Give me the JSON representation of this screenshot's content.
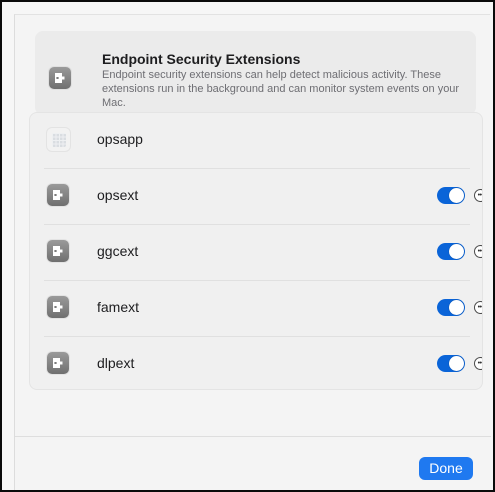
{
  "header": {
    "title": "Endpoint Security Extensions",
    "description": "Endpoint security extensions can help detect malicious activity. These extensions run in the background and can monitor system events on your Mac.",
    "icon": "extension-icon"
  },
  "extensions": [
    {
      "name": "opsapp",
      "icon": "app-grid-icon",
      "has_toggle": false
    },
    {
      "name": "opsext",
      "icon": "extension-icon",
      "has_toggle": true,
      "enabled": true
    },
    {
      "name": "ggcext",
      "icon": "extension-icon",
      "has_toggle": true,
      "enabled": true
    },
    {
      "name": "famext",
      "icon": "extension-icon",
      "has_toggle": true,
      "enabled": true
    },
    {
      "name": "dlpext",
      "icon": "extension-icon",
      "has_toggle": true,
      "enabled": true
    }
  ],
  "footer": {
    "done_label": "Done"
  },
  "colors": {
    "accent": "#0a64d8",
    "button": "#1f79f0",
    "icon_gray": "#8a8a8a"
  }
}
